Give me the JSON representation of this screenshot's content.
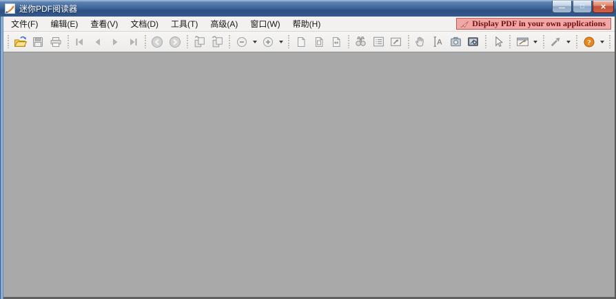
{
  "window": {
    "title": "迷你PDF阅读器",
    "controls": {
      "minimize": "—",
      "maximize": "□",
      "close": "×"
    }
  },
  "menubar": {
    "items": [
      "文件(F)",
      "编辑(E)",
      "查看(V)",
      "文档(D)",
      "工具(T)",
      "高级(A)",
      "窗口(W)",
      "帮助(H)"
    ]
  },
  "banner": {
    "label": "Display PDF in your own applications",
    "icon": "arrow-plane-icon"
  },
  "toolbar": {
    "buttons": [
      {
        "name": "open",
        "icon": "open-folder-icon",
        "enabled": true
      },
      {
        "name": "save",
        "icon": "floppy-disk-icon",
        "enabled": false
      },
      {
        "name": "print",
        "icon": "printer-icon",
        "enabled": false
      },
      {
        "name": "first-page",
        "icon": "first-page-icon",
        "enabled": false
      },
      {
        "name": "previous-page",
        "icon": "previous-page-icon",
        "enabled": false
      },
      {
        "name": "next-page",
        "icon": "next-page-icon",
        "enabled": false
      },
      {
        "name": "last-page",
        "icon": "last-page-icon",
        "enabled": false
      },
      {
        "name": "previous-view",
        "icon": "back-circle-icon",
        "enabled": false
      },
      {
        "name": "next-view",
        "icon": "forward-circle-icon",
        "enabled": false
      },
      {
        "name": "rotate-left",
        "icon": "rotate-pages-left-icon",
        "enabled": false
      },
      {
        "name": "rotate-right",
        "icon": "rotate-pages-right-icon",
        "enabled": false
      },
      {
        "name": "zoom-out",
        "icon": "zoom-out-icon",
        "enabled": false,
        "dropdown": true
      },
      {
        "name": "zoom-in",
        "icon": "zoom-in-icon",
        "enabled": false,
        "dropdown": true
      },
      {
        "name": "actual-size",
        "icon": "page-actual-size-icon",
        "enabled": false
      },
      {
        "name": "fit-page",
        "icon": "page-fit-icon",
        "enabled": false
      },
      {
        "name": "fit-width",
        "icon": "page-fit-width-icon",
        "enabled": false
      },
      {
        "name": "find",
        "icon": "binoculars-icon",
        "enabled": false
      },
      {
        "name": "page-thumbnails",
        "icon": "list-panel-icon",
        "enabled": false
      },
      {
        "name": "full-screen",
        "icon": "box-arrow-icon",
        "enabled": false
      },
      {
        "name": "hand-tool",
        "icon": "hand-icon",
        "enabled": false
      },
      {
        "name": "select-text",
        "icon": "text-select-icon",
        "enabled": false
      },
      {
        "name": "snapshot",
        "icon": "camera-icon",
        "enabled": false
      },
      {
        "name": "magnifier",
        "icon": "dark-window-icon",
        "enabled": true
      },
      {
        "name": "select-annotation",
        "icon": "cursor-arrow-icon",
        "enabled": true
      },
      {
        "name": "annotate",
        "icon": "window-pen-icon",
        "enabled": true,
        "dropdown": true
      },
      {
        "name": "link-tool",
        "icon": "ne-arrow-icon",
        "enabled": true,
        "dropdown": true
      },
      {
        "name": "help",
        "icon": "help-question-icon",
        "enabled": true,
        "dropdown": true
      }
    ]
  },
  "colors": {
    "titlebar_blue": "#40669b",
    "close_red": "#c2503a",
    "banner_bg": "#f2a7a7",
    "banner_border": "#b95c5c",
    "banner_text": "#701010",
    "menubar_bg": "#f2f1ef",
    "toolbar_bg": "#f2f1ef",
    "content_bg": "#a9a9a9",
    "help_orange": "#e8871f",
    "folder_yellow": "#fbd15c"
  }
}
